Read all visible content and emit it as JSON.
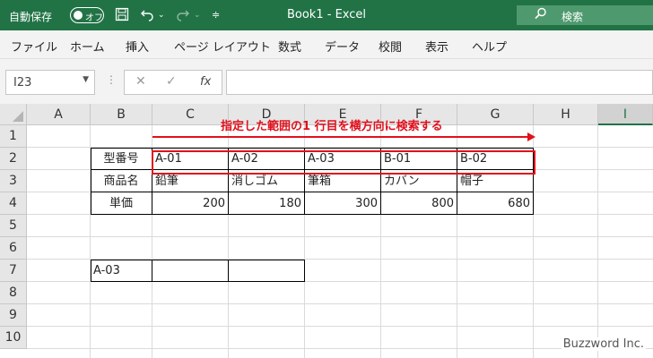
{
  "titlebar": {
    "autosave_label": "自動保存",
    "toggle_text": "オフ",
    "title": "Book1  -  Excel",
    "search_label": "検索"
  },
  "menu": [
    "ファイル",
    "ホーム",
    "挿入",
    "ページ レイアウト",
    "数式",
    "データ",
    "校閲",
    "表示",
    "ヘルプ"
  ],
  "formula_bar": {
    "name_box": "I23",
    "formula": ""
  },
  "columns": [
    "A",
    "B",
    "C",
    "D",
    "E",
    "F",
    "G",
    "H",
    "I"
  ],
  "selected_column": "I",
  "rows": [
    "1",
    "2",
    "3",
    "4",
    "5",
    "6",
    "7",
    "8",
    "9",
    "10"
  ],
  "cells": {
    "B2": "型番号",
    "C2": "A-01",
    "D2": "A-02",
    "E2": "A-03",
    "F2": "B-01",
    "G2": "B-02",
    "B3": "商品名",
    "C3": "鉛筆",
    "D3": "消しゴム",
    "E3": "筆箱",
    "F3": "カバン",
    "G3": "帽子",
    "B4": "単価",
    "C4": "200",
    "D4": "180",
    "E4": "300",
    "F4": "800",
    "G4": "680",
    "B7": "A-03",
    "C7": "",
    "D7": ""
  },
  "annotation": {
    "text": "指定した範囲の1 行目を横方向に検索する",
    "color": "#e0101c"
  },
  "watermark": "Buzzword Inc.",
  "colors": {
    "excel_green": "#217346",
    "annotation_red": "#e0101c"
  }
}
